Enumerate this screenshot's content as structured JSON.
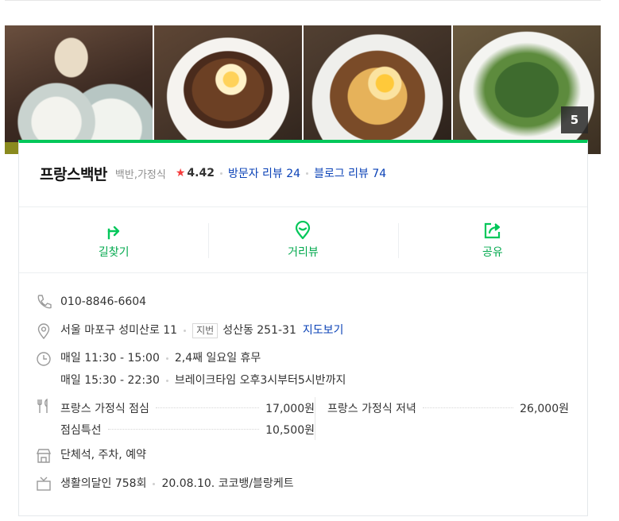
{
  "photos": {
    "count_badge": "5",
    "items": [
      {
        "alt": "photo-1"
      },
      {
        "alt": "photo-2"
      },
      {
        "alt": "photo-3"
      },
      {
        "alt": "photo-4"
      }
    ]
  },
  "place": {
    "name": "프랑스백반",
    "category": "백반,가정식",
    "rating_star": "★",
    "rating": "4.42",
    "visitor_review": "방문자 리뷰 24",
    "blog_review": "블로그 리뷰 74"
  },
  "actions": [
    {
      "label": "길찾기",
      "icon": "directions-icon"
    },
    {
      "label": "거리뷰",
      "icon": "street-view-icon"
    },
    {
      "label": "공유",
      "icon": "share-icon"
    }
  ],
  "info": {
    "phone": "010-8846-6604",
    "address": "서울 마포구 성미산로 11",
    "jibun_label": "지번",
    "jibun_address": "성산동 251-31",
    "map_link": "지도보기",
    "hours": [
      {
        "time": "매일 11:30 - 15:00",
        "note": "2,4째 일요일 휴무"
      },
      {
        "time": "매일 15:30 - 22:30",
        "note": "브레이크타임 오후3시부터5시반까지"
      }
    ],
    "menu": [
      {
        "name": "프랑스 가정식 점심",
        "price": "17,000원"
      },
      {
        "name": "프랑스 가정식 저녁",
        "price": "26,000원"
      },
      {
        "name": "점심특선",
        "price": "10,500원"
      }
    ],
    "amenities": "단체석, 주차, 예약",
    "tv_show": "생활의달인 758회",
    "tv_detail": "20.08.10. 코코뱅/블랑케트"
  },
  "colors": {
    "accent_green": "#03c75a",
    "link_blue": "#0c43b7",
    "star_red": "#f53c3c"
  }
}
